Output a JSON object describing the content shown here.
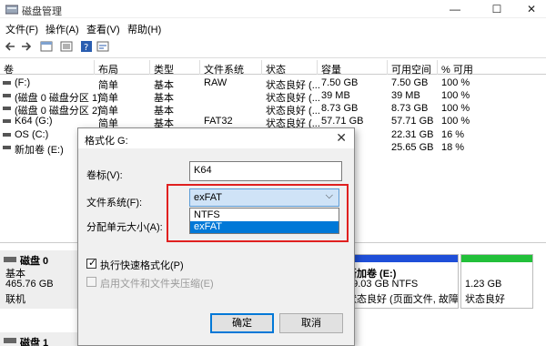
{
  "window": {
    "title": "磁盘管理",
    "min": "—",
    "max": "☐",
    "close": "✕"
  },
  "menu": [
    "文件(F)",
    "操作(A)",
    "查看(V)",
    "帮助(H)"
  ],
  "columns": [
    "卷",
    "布局",
    "类型",
    "文件系统",
    "状态",
    "容量",
    "可用空间",
    "% 可用"
  ],
  "volumes": [
    {
      "name": "(F:)",
      "layout": "简单",
      "type": "基本",
      "fs": "RAW",
      "status": "状态良好 (...",
      "capacity": "7.50 GB",
      "free": "7.50 GB",
      "pct": "100 %"
    },
    {
      "name": "(磁盘 0 磁盘分区 1)",
      "layout": "简单",
      "type": "基本",
      "fs": "",
      "status": "状态良好 (...",
      "capacity": "39 MB",
      "free": "39 MB",
      "pct": "100 %"
    },
    {
      "name": "(磁盘 0 磁盘分区 2)",
      "layout": "简单",
      "type": "基本",
      "fs": "",
      "status": "状态良好 (...",
      "capacity": "8.73 GB",
      "free": "8.73 GB",
      "pct": "100 %"
    },
    {
      "name": "K64 (G:)",
      "layout": "简单",
      "type": "基本",
      "fs": "FAT32",
      "status": "状态良好 (...",
      "capacity": "57.71 GB",
      "free": "57.71 GB",
      "pct": "100 %"
    },
    {
      "name": "OS (C:)",
      "layout": "",
      "type": "",
      "fs": "",
      "status": "",
      "capacity": "",
      "free": "22.31 GB",
      "pct": "16 %"
    },
    {
      "name": "新加卷 (E:)",
      "layout": "",
      "type": "",
      "fs": "",
      "status": "",
      "capacity": "",
      "free": "25.65 GB",
      "pct": "18 %"
    }
  ],
  "disk0": {
    "name": "磁盘 0",
    "type": "基本",
    "size": "465.76 GB",
    "state": "联机"
  },
  "disk1": {
    "name": "磁盘 1"
  },
  "partitions": {
    "e_title": "新加卷 (E:)",
    "e_size": "19.03 GB NTFS",
    "e_status": "状态良好 (页面文件, 故障转储, 基",
    "small_size": "1.23 GB",
    "small_status": "状态良好"
  },
  "dialog": {
    "title": "格式化 G:",
    "close": "✕",
    "volume_label": "卷标(V):",
    "volume_value": "K64",
    "fs_label": "文件系统(F):",
    "fs_selected": "exFAT",
    "fs_options": [
      "NTFS",
      "exFAT"
    ],
    "alloc_label": "分配单元大小(A):",
    "quick_format": "执行快速格式化(P)",
    "compression": "启用文件和文件夹压缩(E)",
    "ok": "确定",
    "cancel": "取消"
  }
}
